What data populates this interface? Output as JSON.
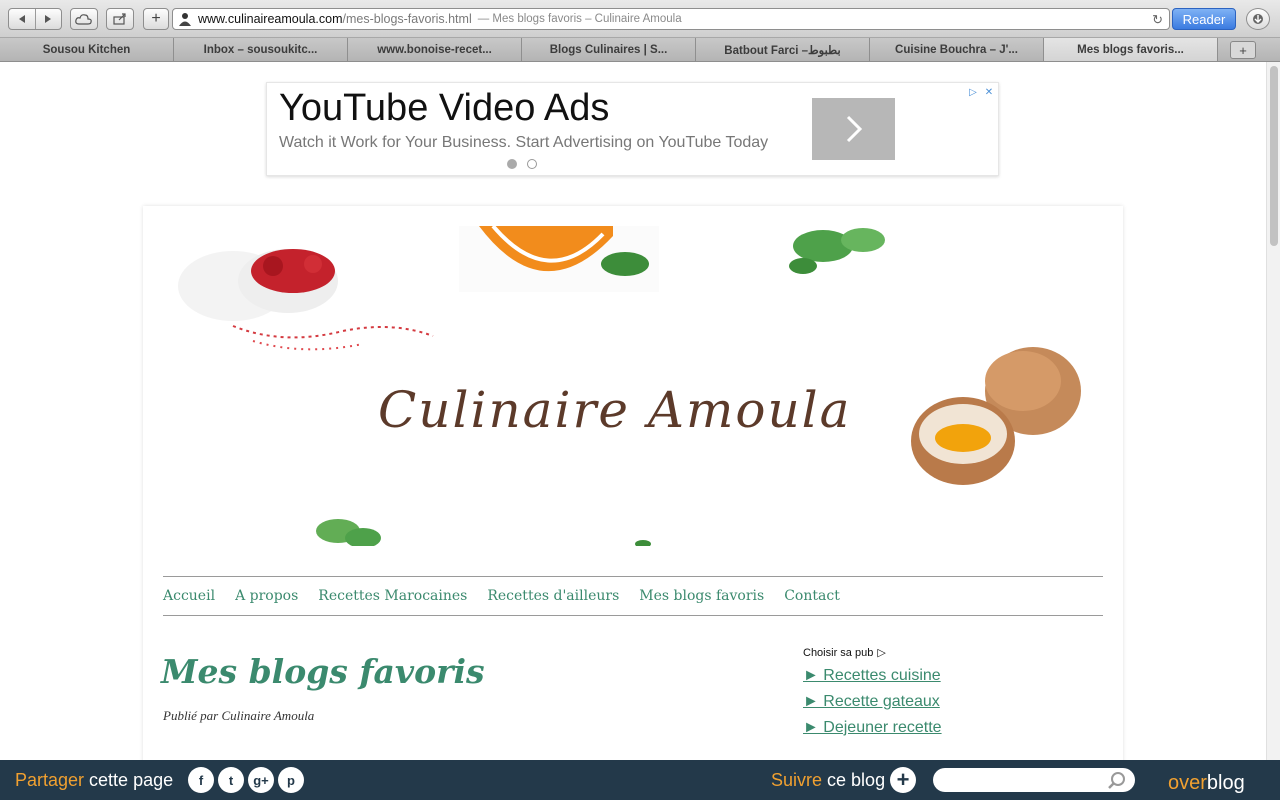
{
  "browser": {
    "url_host": "www.culinaireamoula.com",
    "url_path": "/mes-blogs-favoris.html",
    "url_title": "— Mes blogs favoris – Culinaire Amoula",
    "reader_label": "Reader",
    "tabs": [
      {
        "label": "Sousou Kitchen"
      },
      {
        "label": "Inbox – sousoukitc..."
      },
      {
        "label": "www.bonoise-recet..."
      },
      {
        "label": "Blogs Culinaires | S..."
      },
      {
        "label": "Batbout Farci –بطبوط"
      },
      {
        "label": "Cuisine Bouchra – J'..."
      },
      {
        "label": "Mes blogs favoris..."
      }
    ]
  },
  "ad": {
    "title": "YouTube Video Ads",
    "description": "Watch it Work for Your Business. Start Advertising on YouTube Today"
  },
  "site": {
    "banner_title": "Culinaire Amoula",
    "nav": [
      "Accueil",
      "A propos",
      "Recettes Marocaines",
      "Recettes d'ailleurs",
      "Mes blogs favoris",
      "Contact"
    ],
    "post_title": "Mes blogs favoris",
    "post_meta": "Publié par Culinaire Amoula",
    "sidebar": {
      "choose_ad": "Choisir sa pub",
      "links": [
        "► Recettes cuisine",
        "► Recette gateaux",
        "► Dejeuner recette"
      ]
    }
  },
  "bottombar": {
    "share_highlight": "Partager",
    "share_rest": " cette page",
    "follow_highlight": "Suivre",
    "follow_rest": " ce blog",
    "brand_highlight": "over",
    "brand_rest": "blog",
    "social": [
      "f",
      "t",
      "g+",
      "p"
    ]
  },
  "colors": {
    "accent_green": "#3b8a6e",
    "bar_bg": "#23394a",
    "orange": "#f0a030"
  }
}
